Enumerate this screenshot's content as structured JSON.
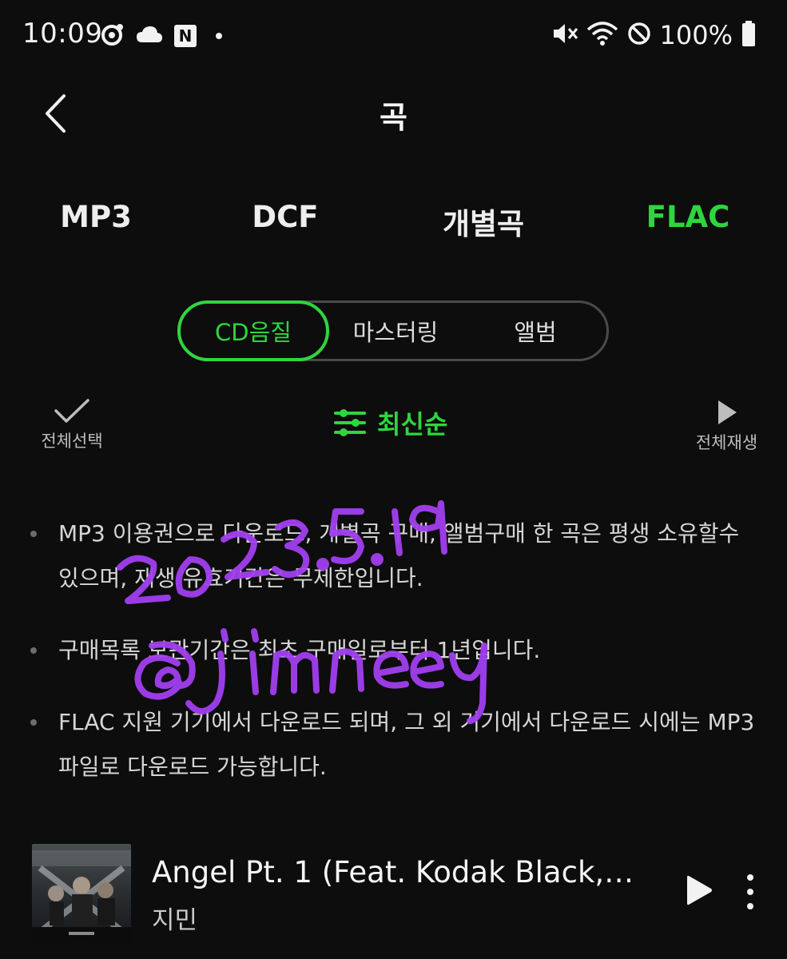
{
  "status_bar": {
    "time": "10:09",
    "notification_badge": "N",
    "battery_text": "100%"
  },
  "header": {
    "title": "곡",
    "back_icon": "chevron-left-icon"
  },
  "format_tabs": [
    {
      "label": "MP3",
      "active": false
    },
    {
      "label": "DCF",
      "active": false
    },
    {
      "label": "개별곡",
      "active": false
    },
    {
      "label": "FLAC",
      "active": true
    }
  ],
  "segment": {
    "items": [
      {
        "label": "CD음질",
        "active": true
      },
      {
        "label": "마스터링",
        "active": false
      },
      {
        "label": "앨범",
        "active": false
      }
    ]
  },
  "toolbar": {
    "select_all_label": "전체선택",
    "sort_label": "최신순",
    "play_all_label": "전체재생"
  },
  "notes": [
    "MP3 이용권으로 다운로드, 개별곡 구매, 앨범구매 한 곡은 평생 소유할수 있으며, 재생 유효기간은 무제한입니다.",
    "구매목록 보관기간은 최초 구매일로부터 1년입니다.",
    "FLAC 지원 기기에서 다운로드 되며, 그 외 기기에서 다운로드 시에는 MP3 파일로 다운로드 가능합니다."
  ],
  "watermark": {
    "date": "2023.5.19",
    "handle": "@jimneey"
  },
  "song": {
    "title": "Angel Pt. 1 (Feat. Kodak Black, ...",
    "artist": "지민"
  },
  "colors": {
    "accent": "#2ed63e",
    "background": "#0d0d0d",
    "watermark": "#a23ff0"
  }
}
